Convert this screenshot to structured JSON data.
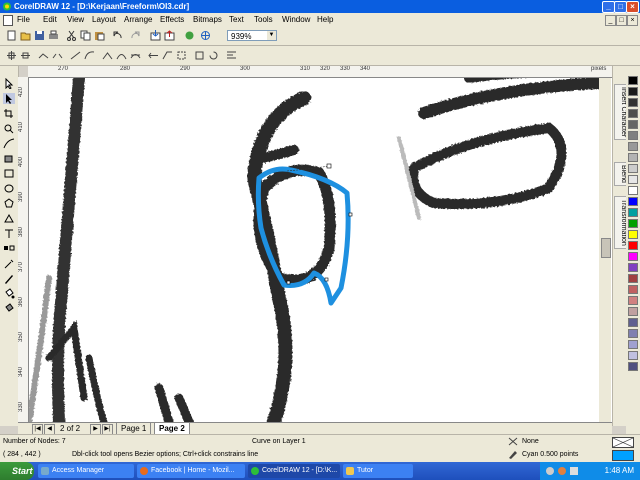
{
  "window": {
    "title": "CorelDRAW 12 - [D:\\Kerjaan\\Freeform\\OI3.cdr]",
    "minimize_glyph": "_",
    "maximize_glyph": "□",
    "close_glyph": "×",
    "title_color": "#0a5ee0"
  },
  "menu": {
    "items": [
      "File",
      "Edit",
      "View",
      "Layout",
      "Arrange",
      "Effects",
      "Bitmaps",
      "Text",
      "Tools",
      "Window",
      "Help"
    ]
  },
  "toolbar": {
    "zoom_value": "939%"
  },
  "rulers": {
    "horizontal_ticks": [
      "270",
      "280",
      "290",
      "300",
      "310",
      "320",
      "330",
      "340"
    ],
    "horizontal_unit": "pixels",
    "vertical_ticks": [
      "420",
      "410",
      "400",
      "390",
      "380",
      "370",
      "360",
      "350",
      "340",
      "330"
    ]
  },
  "dockers": {
    "tabs": [
      "Insert Character",
      "Blend",
      "Transformation"
    ]
  },
  "palette": {
    "colors": [
      "#000000",
      "#1a1a1a",
      "#333333",
      "#4d4d4d",
      "#666666",
      "#808080",
      "#999999",
      "#b3b3b3",
      "#cccccc",
      "#e6e6e6",
      "#ffffff",
      "#0000ff",
      "#00a0a0",
      "#00a000",
      "#ffff00",
      "#ff0000",
      "#ff00ff",
      "#8040c0",
      "#a04040",
      "#c06060",
      "#d08080",
      "#c0a0a0",
      "#606090",
      "#8080b0",
      "#a0a0d0",
      "#c0c0e0",
      "#505080"
    ]
  },
  "pagebar": {
    "counter": "2 of 2",
    "tabs": [
      "Page 1",
      "Page 2"
    ],
    "active_tab": "Page 2"
  },
  "status": {
    "nodes": "Number of Nodes: 7",
    "coords": "( 284 , 442 )",
    "layer": "Curve on Layer 1",
    "hint": "Dbl-click tool opens Bezier options; Ctrl+click constrains line",
    "fill": "None",
    "outline": "Cyan  0.500 points",
    "outline_color": "#00a0ff"
  },
  "taskbar": {
    "start_label": "Start",
    "tasks": [
      {
        "label": "Access Manager",
        "active": false
      },
      {
        "label": "Facebook | Home - Mozil...",
        "active": false
      },
      {
        "label": "CorelDRAW 12 - [D:\\K...",
        "active": true
      },
      {
        "label": "Tutor",
        "active": false
      }
    ],
    "clock": "1:48 AM"
  },
  "curve": {
    "stroke_color": "#1e90e0"
  }
}
